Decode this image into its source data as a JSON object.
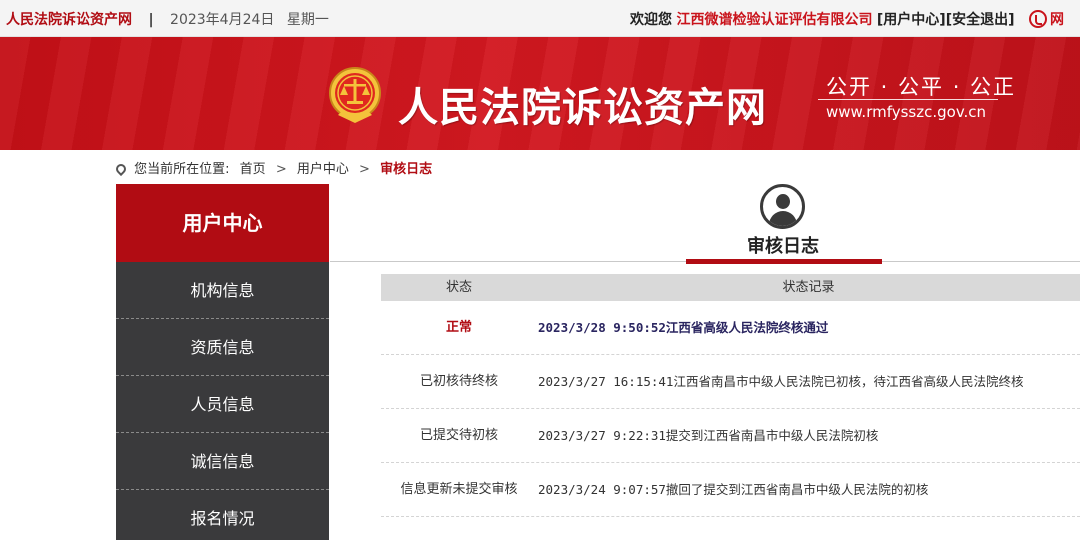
{
  "topbar": {
    "site_name": "人民法院诉讼资产网",
    "separator": "|",
    "date": "2023年4月24日",
    "weekday": "星期一",
    "welcome": "欢迎您",
    "company": "江西微谱检验认证评估有限公司",
    "user_center_link": "[用户中心]",
    "logout_link": "[安全退出]",
    "right_cut_text": "网"
  },
  "banner": {
    "title": "人民法院诉讼资产网",
    "slogan": "公开 · 公平 · 公正",
    "url": "www.rmfysszc.gov.cn"
  },
  "breadcrumb": {
    "prefix": "您当前所在位置:",
    "items": [
      "首页",
      "用户中心"
    ],
    "current": "审核日志",
    "separator": ">"
  },
  "sidebar": {
    "title": "用户中心",
    "items": [
      {
        "label": "机构信息"
      },
      {
        "label": "资质信息"
      },
      {
        "label": "人员信息"
      },
      {
        "label": "诚信信息"
      },
      {
        "label": "报名情况"
      }
    ]
  },
  "main": {
    "section_title": "审核日志",
    "table": {
      "headers": [
        "状态",
        "状态记录"
      ],
      "rows": [
        {
          "status": "正常",
          "record": "2023/3/28 9:50:52江西省高级人民法院终核通过",
          "highlight": true
        },
        {
          "status": "已初核待终核",
          "record": "2023/3/27 16:15:41江西省南昌市中级人民法院已初核，待江西省高级人民法院终核",
          "highlight": false
        },
        {
          "status": "已提交待初核",
          "record": "2023/3/27 9:22:31提交到江西省南昌市中级人民法院初核",
          "highlight": false
        },
        {
          "status": "信息更新未提交审核",
          "record": "2023/3/24 9:07:57撤回了提交到江西省南昌市中级人民法院的初核",
          "highlight": false
        }
      ]
    }
  },
  "colors": {
    "brand_red": "#b10c13",
    "sidebar_dark": "#3a3a3c"
  }
}
